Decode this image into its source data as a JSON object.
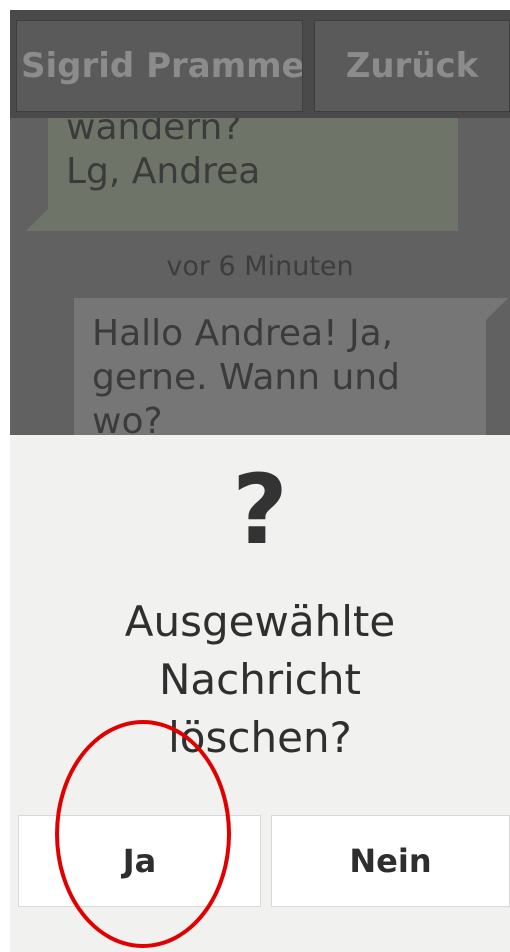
{
  "header": {
    "contact_label": "Sigrid Pramme",
    "back_label": "Zurück"
  },
  "chat": {
    "incoming": {
      "lines": [
        "wandern?",
        "Lg, Andrea"
      ]
    },
    "timestamp": "vor 6 Minuten",
    "outgoing": {
      "lines": [
        "Hallo Andrea! Ja,",
        "gerne. Wann und",
        "wo?"
      ]
    }
  },
  "dialog": {
    "icon": "question-mark-icon",
    "icon_glyph": "?",
    "prompt_lines": [
      "Ausgewählte",
      "Nachricht",
      "löschen?"
    ],
    "yes_label": "Ja",
    "no_label": "Nein"
  },
  "colors": {
    "highlight": "#e00000",
    "dialog_background": "#f1f1f0",
    "header_background": "#4a4a4a"
  }
}
